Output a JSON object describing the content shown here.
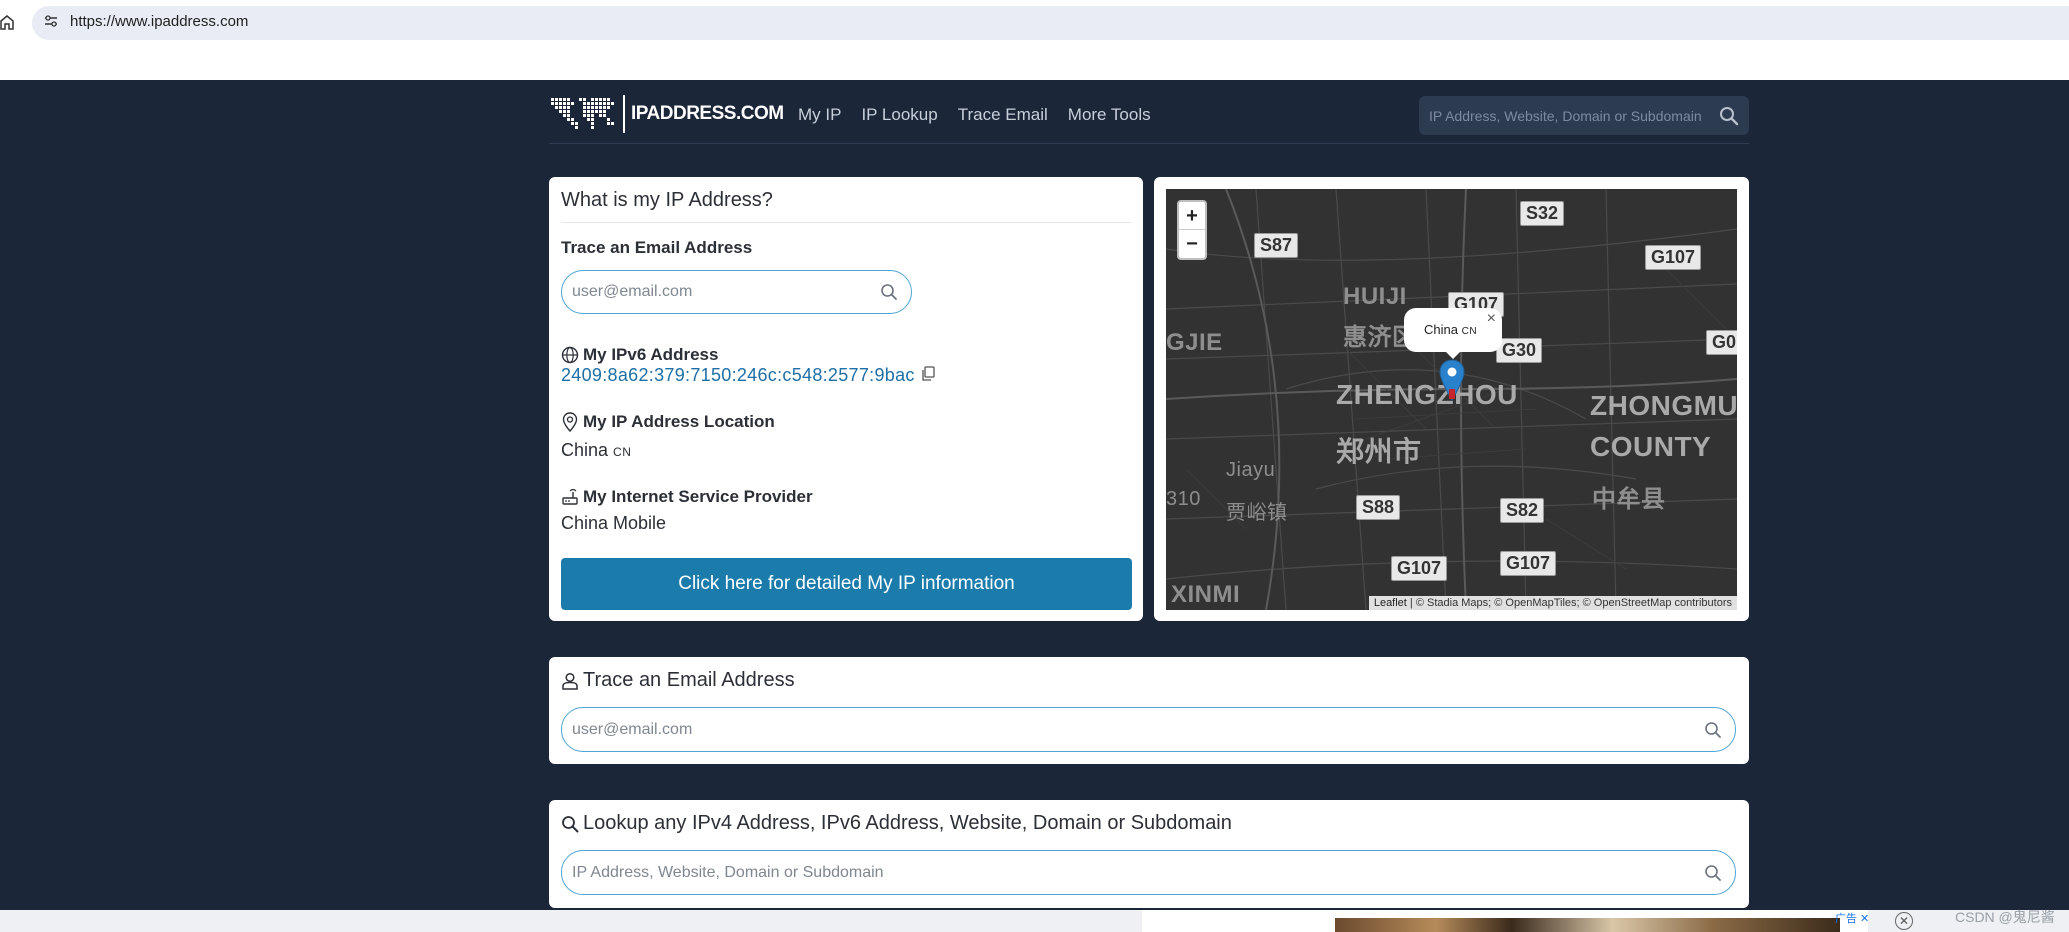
{
  "browser": {
    "url": "https://www.ipaddress.com"
  },
  "header": {
    "logo_text": "IPADDRESS.COM",
    "nav": [
      "My IP",
      "IP Lookup",
      "Trace Email",
      "More Tools"
    ],
    "search_placeholder": "IP Address, Website, Domain or Subdomain"
  },
  "ip_card": {
    "title": "What is my IP Address?",
    "trace_label": "Trace an Email Address",
    "trace_placeholder": "user@email.com",
    "ipv6_label": "My IPv6 Address",
    "ipv6_value": "2409:8a62:379:7150:246c:c548:2577:9bac",
    "location_label": "My IP Address Location",
    "location_value": "China",
    "location_cc": "CN",
    "isp_label": "My Internet Service Provider",
    "isp_value": "China Mobile",
    "detail_button": "Click here for detailed My IP information"
  },
  "map": {
    "zoom_in": "+",
    "zoom_out": "−",
    "popup_text": "China",
    "popup_cc": "CN",
    "popup_close": "×",
    "attribution_leaflet": "Leaflet",
    "attribution_rest": " | © Stadia Maps; © OpenMapTiles; © OpenStreetMap contributors",
    "shields": [
      "S32",
      "S87",
      "G107",
      "G107",
      "G30",
      "G0",
      "S88",
      "S82",
      "G107",
      "G107"
    ],
    "labels": [
      "HUIJI",
      "惠济区",
      "ZHENGZHOU",
      "郑州市",
      "ZHONGMU",
      "COUNTY",
      "中牟县",
      "GJIE",
      "Jiayu",
      "贾峪镇",
      "310",
      "XINMI"
    ]
  },
  "trace_card": {
    "title": "Trace an Email Address",
    "placeholder": "user@email.com"
  },
  "lookup_card": {
    "title": "Lookup any IPv4 Address, IPv6 Address, Website, Domain or Subdomain",
    "placeholder": "IP Address, Website, Domain or Subdomain"
  },
  "ad": {
    "tag": "广告 ✕",
    "close": "✕"
  },
  "watermark": "CSDN @鬼尼酱",
  "colors": {
    "page_bg": "#1b2638",
    "primary_button": "#1b7bab",
    "link": "#1d6fa6",
    "input_border": "#4ea5d3"
  }
}
